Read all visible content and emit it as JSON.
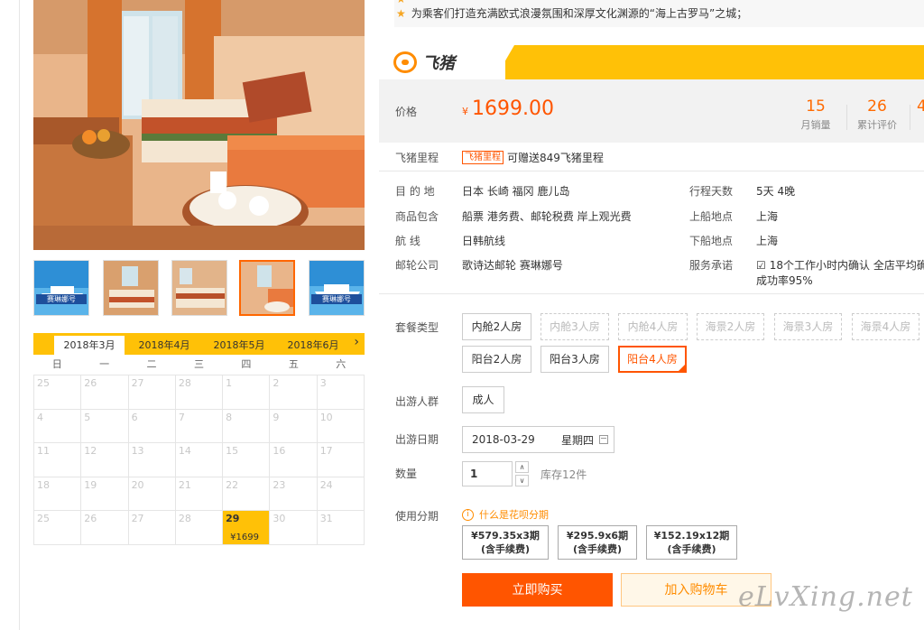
{
  "notes": [
    "",
    "为乘客们打造充满欧式浪漫氛围和深厚文化渊源的“海上古罗马”之城；"
  ],
  "brand": {
    "name": "飞猪"
  },
  "price": {
    "label": "价格",
    "currency": "¥",
    "value": "1699.00"
  },
  "stats": [
    {
      "value": "15",
      "label": "月销量"
    },
    {
      "value": "26",
      "label": "累计评价"
    },
    {
      "value": "4",
      "label": ""
    }
  ],
  "miles": {
    "label": "飞猪里程",
    "tag": "飞猪里程",
    "text": "可赠送849飞猪里程"
  },
  "details_left": [
    {
      "key": "目 的 地",
      "value": "日本  长崎  福冈  鹿儿岛"
    },
    {
      "key": "商品包含",
      "value": "船票  港务费、邮轮税费  岸上观光费"
    },
    {
      "key": "航    线",
      "value": "日韩航线"
    },
    {
      "key": "邮轮公司",
      "value": "歌诗达邮轮  赛琳娜号"
    }
  ],
  "details_right": [
    {
      "key": "行程天数",
      "value": "5天  4晚"
    },
    {
      "key": "上船地点",
      "value": "上海"
    },
    {
      "key": "下船地点",
      "value": "上海"
    },
    {
      "key": "服务承诺",
      "value": "18个工作小时内确认 全店平均确认",
      "value2": "成功率95%"
    }
  ],
  "package": {
    "label": "套餐类型",
    "options": [
      "内舱2人房",
      "内舱3人房",
      "内舱4人房",
      "海景2人房",
      "海景3人房",
      "海景4人房",
      "阳台2人房",
      "阳台3人房",
      "阳台4人房"
    ],
    "selected": "阳台4人房"
  },
  "crowd": {
    "label": "出游人群",
    "option": "成人"
  },
  "travel_date": {
    "label": "出游日期",
    "date": "2018-03-29",
    "weekday": "星期四"
  },
  "quantity": {
    "label": "数量",
    "value": "1",
    "stock": "库存12件",
    "up": "∧",
    "down": "∨"
  },
  "installment": {
    "label": "使用分期",
    "help": "什么是花呗分期",
    "plans": [
      {
        "line1": "¥579.35x3期",
        "line2": "(含手续费)"
      },
      {
        "line1": "¥295.9x6期",
        "line2": "(含手续费)"
      },
      {
        "line1": "¥152.19x12期",
        "line2": "(含手续费)"
      }
    ]
  },
  "actions": {
    "buy": "立即购买",
    "cart": "加入购物车"
  },
  "calendar": {
    "months": [
      "2018年3月",
      "2018年4月",
      "2018年5月",
      "2018年6月"
    ],
    "active_month": "2018年3月",
    "next_arrow": "›",
    "weekdays": [
      "日",
      "一",
      "二",
      "三",
      "四",
      "五",
      "六"
    ],
    "weeks": [
      [
        "25",
        "26",
        "27",
        "28",
        "1",
        "2",
        "3"
      ],
      [
        "4",
        "5",
        "6",
        "7",
        "8",
        "9",
        "10"
      ],
      [
        "11",
        "12",
        "13",
        "14",
        "15",
        "16",
        "17"
      ],
      [
        "18",
        "19",
        "20",
        "21",
        "22",
        "23",
        "24"
      ],
      [
        "25",
        "26",
        "27",
        "28",
        "29",
        "30",
        "31"
      ]
    ],
    "selected_day": "29",
    "selected_price": "¥1699"
  },
  "thumbnails": [
    {
      "name": "ship-poster",
      "label": "赛琳娜号"
    },
    {
      "name": "cabin-1",
      "label": ""
    },
    {
      "name": "cabin-2",
      "label": ""
    },
    {
      "name": "cabin-3",
      "label": ""
    },
    {
      "name": "ship-poster-2",
      "label": "赛琳娜号"
    }
  ],
  "watermark": "eLvXing.net",
  "colors": {
    "accent": "#ff5500",
    "brand_yellow": "#ffc107",
    "stat_orange": "#ff6a00"
  }
}
